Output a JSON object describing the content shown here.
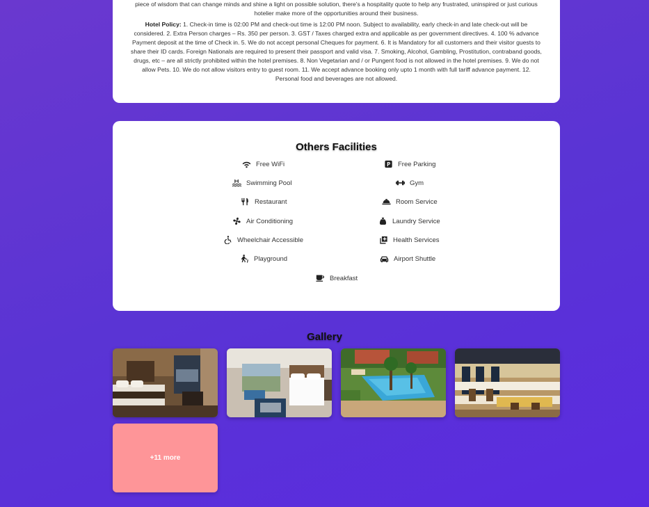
{
  "policy": {
    "intro_text": "piece of wisdom that can change minds and shine a light on possible solution, there's a hospitality quote to help any frustrated, uninspired or just curious hotelier make more of the opportunities around their business.",
    "label": "Hotel Policy:",
    "text": " 1. Check-in time is 02:00 PM and check-out time is 12:00 PM noon. Subject to availability, early check-in and late check-out will be considered. 2. Extra Person charges – Rs. 350 per person. 3. GST / Taxes charged extra and applicable as per government directives. 4. 100 % advance Payment deposit at the time of Check in. 5. We do not accept personal Cheques for payment. 6. It is Mandatory for all customers and their visitor guests to share their ID cards. Foreign Nationals are required to present their passport and valid visa. 7. Smoking, Alcohol, Gambling, Prostitution, contraband goods, drugs, etc – are all strictly prohibited within the hotel premises. 8. Non Vegetarian and / or Pungent food is not allowed in the hotel premises. 9. We do not allow Pets. 10. We do not allow visitors entry to guest room. 11. We accept advance booking only upto 1 month with full tariff advance payment. 12. Personal food and beverages are not allowed."
  },
  "facilities": {
    "title": "Others Facilities",
    "items": [
      {
        "label": "Free WiFi",
        "icon": "wifi-icon"
      },
      {
        "label": "Free Parking",
        "icon": "parking-icon"
      },
      {
        "label": "Swimming Pool",
        "icon": "swimming-pool-icon"
      },
      {
        "label": "Gym",
        "icon": "dumbbell-icon"
      },
      {
        "label": "Restaurant",
        "icon": "utensils-icon"
      },
      {
        "label": "Room Service",
        "icon": "concierge-bell-icon"
      },
      {
        "label": "Air Conditioning",
        "icon": "fan-icon"
      },
      {
        "label": "Laundry Service",
        "icon": "laundry-bag-icon"
      },
      {
        "label": "Wheelchair Accessible",
        "icon": "wheelchair-icon"
      },
      {
        "label": "Health Services",
        "icon": "medical-kit-icon"
      },
      {
        "label": "Playground",
        "icon": "child-playing-icon"
      },
      {
        "label": "Airport Shuttle",
        "icon": "car-icon"
      },
      {
        "label": "Breakfast",
        "icon": "coffee-mug-icon"
      }
    ]
  },
  "gallery": {
    "title": "Gallery",
    "images": [
      {
        "subject": "hotel bedroom with city view"
      },
      {
        "subject": "modern hotel room with white bed"
      },
      {
        "subject": "outdoor swimming pool with palm trees"
      },
      {
        "subject": "hotel restaurant dining hall"
      }
    ],
    "more_label": "+11 more"
  }
}
